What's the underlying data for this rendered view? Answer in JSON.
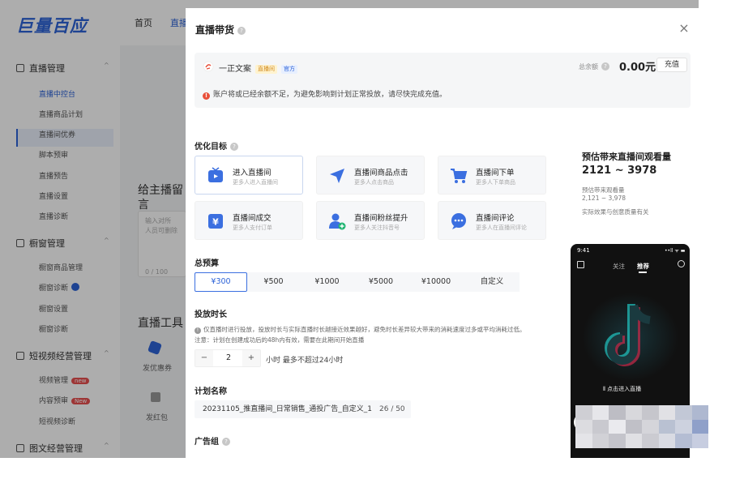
{
  "bg": {
    "logo": "巨量百应",
    "nav": [
      "首页",
      "直播"
    ],
    "sidebar": {
      "group1": "直播管理",
      "group1_items": [
        "直播中控台",
        "直播商品计划",
        "直播间优券",
        "脚本预审",
        "直播预告",
        "直播设置",
        "直播诊断"
      ],
      "group2": "橱窗管理",
      "group2_items": [
        "橱窗商品管理",
        "橱窗诊断",
        "橱窗设置",
        "橱窗诊断"
      ],
      "group3": "短视频经营管理",
      "group3_items": [
        "视频管理",
        "内容预审",
        "短视频诊断"
      ],
      "new_badge": "new",
      "new_badge2": "New",
      "group4": "图文经营管理"
    },
    "main": {
      "text1a": "给主播留",
      "text1b": "言",
      "textarea_placeholder_1": "输入对所",
      "textarea_placeholder_2": "人员可删除",
      "textarea_count": "0 / 100",
      "tools_title": "直播工具",
      "tool1": "发优惠券",
      "tool2": "发红包"
    }
  },
  "drawer": {
    "title": "直播带货",
    "close": "×",
    "account": {
      "name": "一正文案",
      "tag_live": "直播间",
      "tag_official": "官方",
      "balance_label": "总余额",
      "balance": "0.00元",
      "recharge": "充值",
      "warning": "账户将或已经余额不足，为避免影响到计划正常投放，请尽快完成充值。"
    },
    "goal": {
      "title": "优化目标",
      "options": [
        {
          "title": "进入直播间",
          "sub": "更多人进入直播间",
          "icon": "tv-icon"
        },
        {
          "title": "直播间商品点击",
          "sub": "更多人点击商品",
          "icon": "cursor-icon"
        },
        {
          "title": "直播间下单",
          "sub": "更多人下单商品",
          "icon": "cart-icon"
        },
        {
          "title": "直播间成交",
          "sub": "更多人支付订单",
          "icon": "yuan-icon"
        },
        {
          "title": "直播间粉丝提升",
          "sub": "更多人关注抖音号",
          "icon": "user-plus-icon"
        },
        {
          "title": "直播间评论",
          "sub": "更多人在直播间评论",
          "icon": "chat-icon"
        }
      ]
    },
    "budget": {
      "title": "总预算",
      "options": [
        "¥300",
        "¥500",
        "¥1000",
        "¥5000",
        "¥10000",
        "自定义"
      ],
      "selected": "¥300"
    },
    "duration": {
      "title": "投放时长",
      "note1": "仅直播时进行投放，投放时长与实际直播时长越接近效果越好，避免时长差异较大带来的消耗速度过多或平均消耗过低。",
      "note2": "注意：计划在创建成功后的48h内有效，需要在此期间开始直播",
      "minus": "−",
      "value": "2",
      "plus": "+",
      "unit": "小时 最多不超过24小时"
    },
    "plan": {
      "title": "计划名称",
      "value": "20231105_推直播间_日常销售_通投广告_自定义_1",
      "count": "26 / 50"
    },
    "adgroup": {
      "title": "广告组"
    },
    "estimate": {
      "title": "预估带来直播间观看量",
      "range": "2121 ~ 3978",
      "sub_label": "预估带来观看量",
      "sub_value": "2,121 ~ 3,978",
      "note": "实际效果与创意质量有关"
    },
    "phone": {
      "time": "9:41",
      "signal": "••ll ᯤ ▬",
      "tab_follow": "关注",
      "tab_recommend": "推荐",
      "enter_live": "点击进入直播"
    }
  },
  "colors": {
    "brand": "#2d63d8",
    "warn": "#e8503a",
    "active_border": "#3b6fe0"
  }
}
